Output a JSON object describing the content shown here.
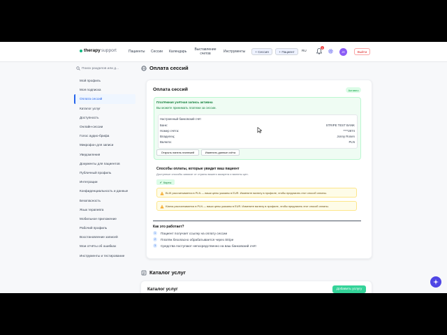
{
  "header": {
    "logo_main": "therapy",
    "logo_sub": "support",
    "nav": [
      "Пациенты",
      "Сессии",
      "Календарь",
      "Выставление счетов",
      "Инструменты"
    ],
    "session_btn": "+ Сессия",
    "patient_btn": "+ Пациент",
    "lang": "RU",
    "notification_count": "1",
    "avatar_initials": "JR",
    "logout": "Выйти"
  },
  "sidebar": {
    "search_placeholder": "Поиск разделов или д...",
    "items": [
      "Мой профиль",
      "Моя подписка",
      "Оплата сессий",
      "Каталог услуг",
      "Доступность",
      "Онлайн-сессии",
      "Голос аудио-брифа",
      "Микрофон для записи",
      "Уведомления",
      "Документы для пациентов",
      "Публичный профиль",
      "Интеграции",
      "Конфиденциальность и данные",
      "Безопасность",
      "Язык терапевта",
      "Мобильное приложение",
      "Рабочий профиль",
      "Восстановление записей",
      "Мои отчёты об ошибках",
      "Инструменты и тестирование"
    ],
    "active_index": 2
  },
  "payments": {
    "section_title": "Оплата сессий",
    "card_title": "Оплата сессий",
    "status": "Активно",
    "account_title": "Платёжная учётная запись активна",
    "account_sub": "Вы можете принимать платежи за сессии.",
    "bank_header": "Настроенный банковский счёт",
    "rows": [
      {
        "label": "Банк:",
        "value": "STRIPE TEST BANK"
      },
      {
        "label": "Номер счёта:",
        "value": "****2874"
      },
      {
        "label": "Владелец:",
        "value": "Jonny Rosen"
      },
      {
        "label": "Валюта:",
        "value": "PLN"
      }
    ],
    "open_panel_btn": "Открыть панель платежей",
    "change_data_btn": "Изменить данные счёта",
    "methods_title": "Способы оплаты, которые увидит ваш пациент",
    "methods_sub": "Доступные способы зависят от страны вашего аккаунта и валюты цен.",
    "method_card": "Карты",
    "warning1": "BLIK рассчитывается в PLN — ваши цены указаны в EUR. Измените валюту в профиле, чтобы предлагать этот способ оплаты.",
    "warning2": "Klarna рассчитывается в PLN — ваши цены указаны в EUR. Измените валюту в профиле, чтобы предлагать этот способ оплаты.",
    "how_title": "Как это работает?",
    "steps": [
      "Пациент получает ссылку на оплату сессии",
      "Платёж безопасно обрабатывается через Stripe",
      "Средства поступают непосредственно на ваш банковский счёт"
    ]
  },
  "catalog": {
    "section_title": "Каталог услуг",
    "card_title": "Каталог услуг",
    "add_btn": "Добавить услугу"
  }
}
